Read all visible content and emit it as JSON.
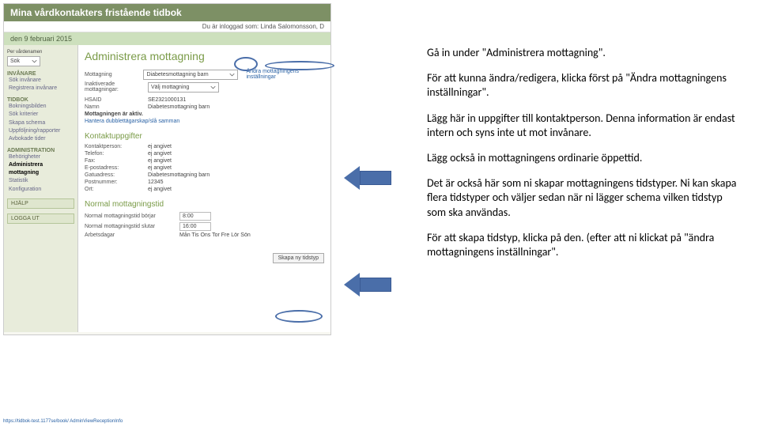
{
  "app": {
    "title": "Mina vårdkontakters fristående tidbok",
    "logged_in_label": "Du är inloggad som: Linda Salomonsson, D",
    "date": "den 9 februari 2015"
  },
  "sidebar": {
    "selector_label": "Per vårdenamen",
    "selector_value": "Sök",
    "groups": [
      {
        "title": "INVÅNARE",
        "items": [
          "Sök invånare",
          "Registrera invånare"
        ]
      },
      {
        "title": "TIDBOK",
        "items": [
          "Bokningsbilden",
          "Sök kriterier",
          "Skapa schema",
          "Uppföljning/rapporter",
          "Avbokade tider"
        ]
      },
      {
        "title": "ADMINISTRATION",
        "items": [
          "Behörigheter",
          "Administrera mottagning",
          "Statistik",
          "Konfiguration"
        ],
        "active_index": 1
      }
    ],
    "help": "HJÄLP",
    "logout": "LOGGA UT"
  },
  "page": {
    "heading": "Administrera mottagning",
    "rows": {
      "mottagning": {
        "label": "Mottagning",
        "value": "Diabetesmottagning barn"
      },
      "inaktiverade": {
        "label": "Inaktiverade mottagningar:",
        "value": "Välj mottagning"
      },
      "hsaid": {
        "label": "HSAID",
        "value": "SE232100013​1"
      },
      "namn": {
        "label": "Namn",
        "value": "Diabetesmottagning barn"
      },
      "aktiv": "Mottagningen är aktiv.",
      "hantera_link": "Hantera dubblettägarskap/slå samman",
      "andra_link": "Ändra mottagningens inställningar"
    },
    "kontakt": {
      "title": "Kontaktuppgifter",
      "fields": [
        {
          "label": "Kontaktperson:",
          "value": "ej angivet"
        },
        {
          "label": "Telefon:",
          "value": "ej angivet"
        },
        {
          "label": "Fax:",
          "value": "ej angivet"
        },
        {
          "label": "E-postadress:",
          "value": "ej angivet"
        },
        {
          "label": "Gatuadress:",
          "value": "Diabetesmottagning barn"
        },
        {
          "label": "Postnummer:",
          "value": "12345"
        },
        {
          "label": "Ort:",
          "value": "ej angivet"
        }
      ]
    },
    "oppettid": {
      "title": "Normal mottagningstid",
      "borjar": {
        "label": "Normal mottagningstid börjar",
        "value": "8:00"
      },
      "slutar": {
        "label": "Normal mottagningstid slutar",
        "value": "16:00"
      },
      "arbetsdagar": {
        "label": "Arbetsdagar",
        "value": "Mån  Tis  Ons  Tor  Fre  Lör  Sön"
      }
    },
    "button": "Skapa ny tidstyp",
    "footer": "https://tidbok-test.1177se/book/ AdminViewReceptionInfo"
  },
  "instructions": {
    "p1": "Gå in under \"Administrera mottagning\".",
    "p2": "För att kunna ändra/redigera, klicka först på \"Ändra mottagningens inställningar\".",
    "p3": "Lägg här in uppgifter till kontaktperson. Denna information är endast intern och syns inte ut mot invånare.",
    "p4": "Lägg också in mottagningens ordinarie öppettid.",
    "p5": "Det är också här som ni skapar mottagningens tidstyper. Ni kan skapa flera tidstyper och väljer sedan när ni lägger schema vilken tidstyp som ska användas.",
    "p6": "För att skapa tidstyp, klicka på den. (efter att ni klickat på \"ändra mottagningens inställningar\"."
  }
}
